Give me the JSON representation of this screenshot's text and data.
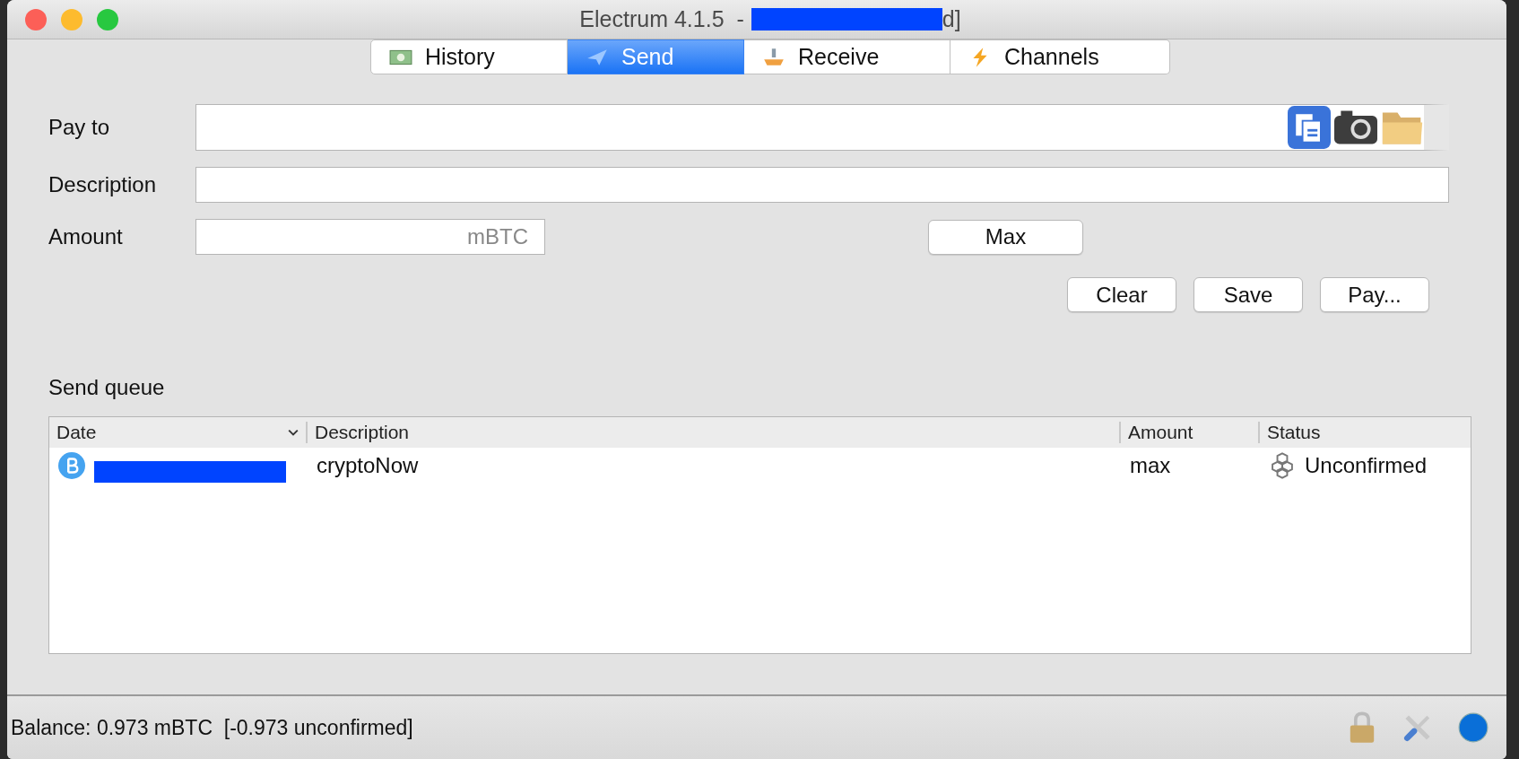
{
  "window": {
    "title": "Electrum 4.1.5  -",
    "title_tail": "d]"
  },
  "tabs": [
    {
      "label": "History",
      "selected": false
    },
    {
      "label": "Send",
      "selected": true
    },
    {
      "label": "Receive",
      "selected": false
    },
    {
      "label": "Channels",
      "selected": false
    }
  ],
  "form": {
    "pay_to_label": "Pay to",
    "description_label": "Description",
    "amount_label": "Amount",
    "amount_field": {
      "placeholder": "mBTC"
    },
    "max_button": "Max"
  },
  "buttons": [
    "Clear",
    "Save",
    "Pay..."
  ],
  "send_queue": {
    "title": "Send queue",
    "columns": [
      "Date",
      "Description",
      "Amount",
      "Status"
    ],
    "rows": [
      {
        "description": "cryptoNow",
        "amount": "max",
        "status": "Unconfirmed"
      }
    ]
  },
  "status_bar": {
    "balance": "Balance: 0.973 mBTC  [-0.973 unconfirmed]"
  }
}
